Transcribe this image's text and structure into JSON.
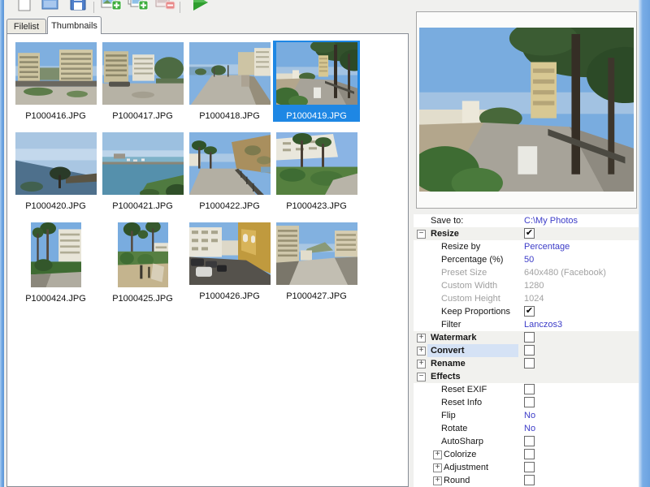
{
  "app": {
    "name": "batch-photo-resizer"
  },
  "colors": {
    "selection_blue": "#1e87e4",
    "value_text_blue": "#3c3cc8",
    "disabled_text": "#9f9f9f",
    "header_row_bg": "#f1f1ee",
    "highlight_row_bg": "#d5e2f5",
    "window_edge_blue": "#74a9e4"
  },
  "toolbar": {
    "items": [
      {
        "name": "new-file-icon"
      },
      {
        "name": "open-file-icon"
      },
      {
        "name": "save-file-icon"
      },
      {
        "name": "separator"
      },
      {
        "name": "add-image-icon"
      },
      {
        "name": "add-folder-icon"
      },
      {
        "name": "remove-image-icon"
      },
      {
        "name": "separator"
      },
      {
        "name": "start-resize-icon"
      }
    ]
  },
  "tabs": [
    {
      "label": "Filelist",
      "active": false
    },
    {
      "label": "Thumbnails",
      "active": true
    }
  ],
  "thumbnails": {
    "items": [
      {
        "name": "P1000416.JPG",
        "scene": "buildings-plaza",
        "shape": "landscape",
        "selected": false
      },
      {
        "name": "P1000417.JPG",
        "scene": "buildings-street",
        "shape": "landscape",
        "selected": false
      },
      {
        "name": "P1000418.JPG",
        "scene": "promenade",
        "shape": "landscape",
        "selected": false
      },
      {
        "name": "P1000419.JPG",
        "scene": "palm-promenade",
        "shape": "landscape",
        "selected": true
      },
      {
        "name": "P1000420.JPG",
        "scene": "sea-sky",
        "shape": "landscape",
        "selected": false
      },
      {
        "name": "P1000421.JPG",
        "scene": "harbor",
        "shape": "landscape",
        "selected": false
      },
      {
        "name": "P1000422.JPG",
        "scene": "hill-walkway",
        "shape": "landscape",
        "selected": false
      },
      {
        "name": "P1000423.JPG",
        "scene": "building-garden",
        "shape": "landscape",
        "selected": false
      },
      {
        "name": "P1000424.JPG",
        "scene": "palms-building",
        "shape": "portrait",
        "selected": false
      },
      {
        "name": "P1000425.JPG",
        "scene": "garden-palms",
        "shape": "portrait",
        "selected": false
      },
      {
        "name": "P1000426.JPG",
        "scene": "street-cars",
        "shape": "landscape",
        "selected": false
      },
      {
        "name": "P1000427.JPG",
        "scene": "street-buildings",
        "shape": "landscape",
        "selected": false
      }
    ]
  },
  "preview": {
    "scene": "palm-promenade",
    "of": "P1000419.JPG"
  },
  "properties": {
    "rows": [
      {
        "label": "Save to:",
        "indent": 1,
        "value": "C:\\My Photos",
        "value_color": "blue"
      },
      {
        "label": "Resize",
        "indent": 1,
        "bold": true,
        "header": true,
        "expander": "minus",
        "checkbox": "checked"
      },
      {
        "label": "Resize by",
        "indent": 2,
        "value": "Percentage",
        "value_color": "blue"
      },
      {
        "label": "Percentage (%)",
        "indent": 2,
        "value": "50",
        "value_color": "blue"
      },
      {
        "label": "Preset Size",
        "indent": 2,
        "disabled": true,
        "value": "640x480 (Facebook)",
        "value_color": "gray"
      },
      {
        "label": "Custom Width",
        "indent": 2,
        "disabled": true,
        "value": "1280",
        "value_color": "gray"
      },
      {
        "label": "Custom Height",
        "indent": 2,
        "disabled": true,
        "value": "1024",
        "value_color": "gray"
      },
      {
        "label": "Keep Proportions",
        "indent": 2,
        "checkbox": "checked"
      },
      {
        "label": "Filter",
        "indent": 2,
        "value": "Lanczos3",
        "value_color": "blue"
      },
      {
        "label": "Watermark",
        "indent": 1,
        "bold": true,
        "header": true,
        "expander": "plus",
        "checkbox": "unchecked"
      },
      {
        "label": "Convert",
        "indent": 1,
        "bold": true,
        "header": true,
        "expander": "plus",
        "checkbox": "unchecked",
        "highlighted": true
      },
      {
        "label": "Rename",
        "indent": 1,
        "bold": true,
        "header": true,
        "expander": "plus",
        "checkbox": "unchecked"
      },
      {
        "label": "Effects",
        "indent": 1,
        "bold": true,
        "header": true,
        "expander": "minus"
      },
      {
        "label": "Reset EXIF",
        "indent": 2,
        "checkbox": "unchecked"
      },
      {
        "label": "Reset Info",
        "indent": 2,
        "checkbox": "unchecked"
      },
      {
        "label": "Flip",
        "indent": 2,
        "value": "No",
        "value_color": "blue"
      },
      {
        "label": "Rotate",
        "indent": 2,
        "value": "No",
        "value_color": "blue"
      },
      {
        "label": "AutoSharp",
        "indent": 2,
        "checkbox": "unchecked"
      },
      {
        "label": "Colorize",
        "indent": 2,
        "expander": "plus",
        "checkbox": "unchecked"
      },
      {
        "label": "Adjustment",
        "indent": 2,
        "expander": "plus",
        "checkbox": "unchecked"
      },
      {
        "label": "Round",
        "indent": 2,
        "expander": "plus",
        "checkbox": "unchecked"
      }
    ]
  }
}
